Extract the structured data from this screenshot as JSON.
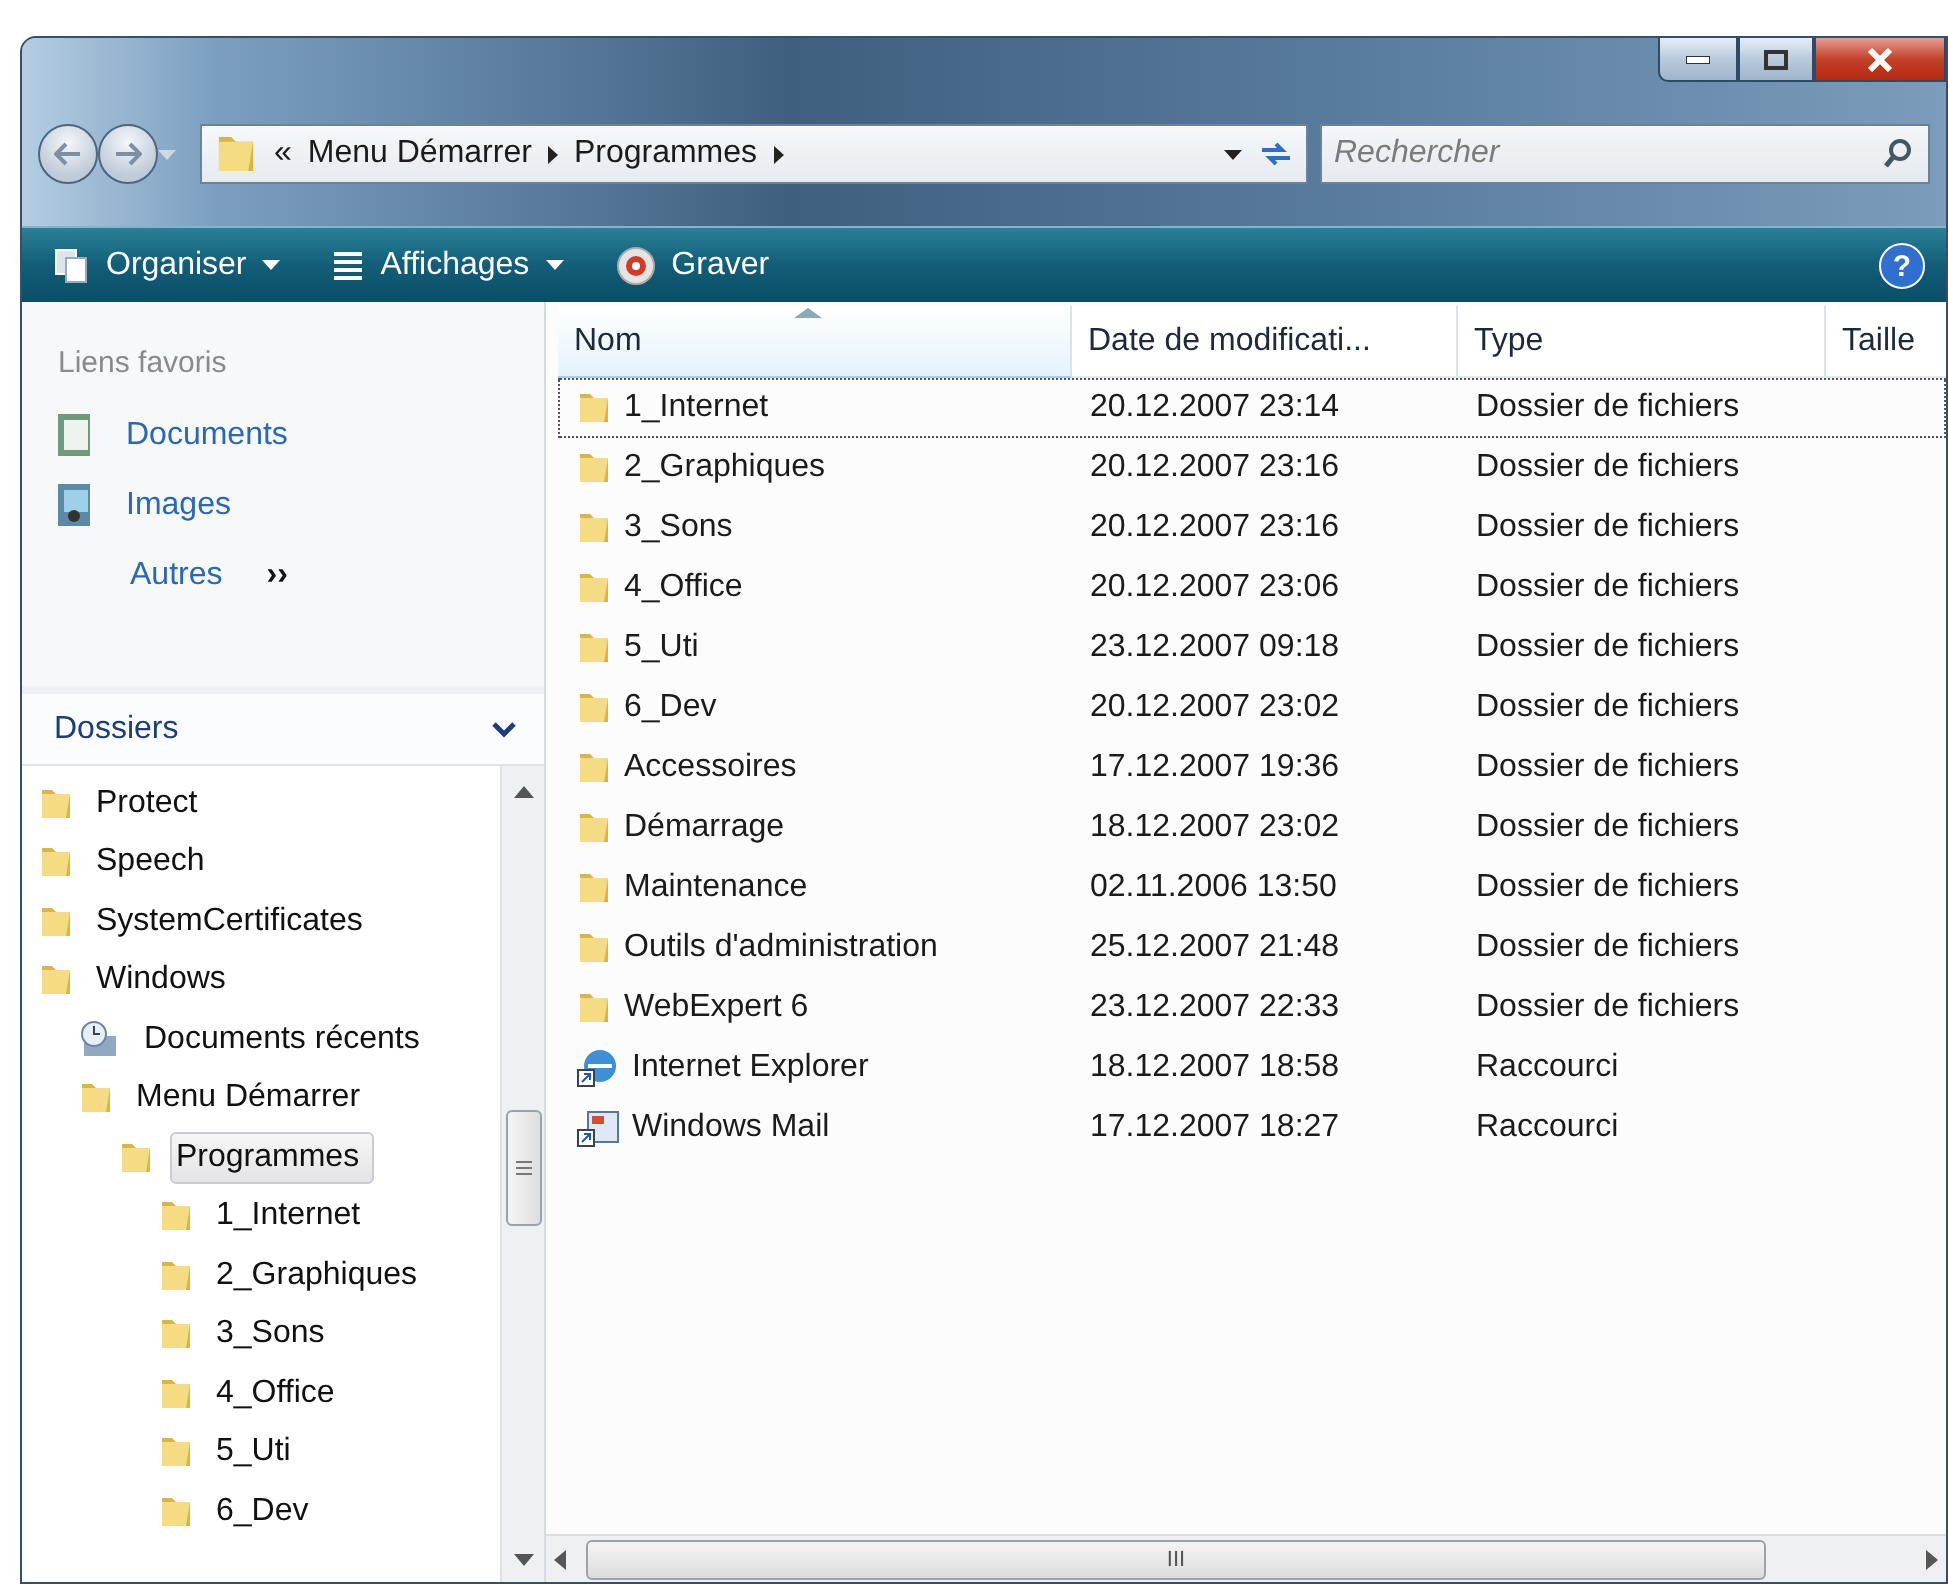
{
  "address_bar": {
    "overflow": "«",
    "crumbs": [
      "Menu Démarrer",
      "Programmes"
    ]
  },
  "search": {
    "placeholder": "Rechercher"
  },
  "toolbar": [
    {
      "label": "Organiser",
      "kind": "organize",
      "dropdown": true
    },
    {
      "label": "Affichages",
      "kind": "views",
      "dropdown": true
    },
    {
      "label": "Graver",
      "kind": "burn",
      "dropdown": false
    }
  ],
  "favorites": {
    "title": "Liens favoris",
    "items": [
      {
        "label": "Documents",
        "kind": "documents"
      },
      {
        "label": "Images",
        "kind": "pictures"
      },
      {
        "label": "Autres",
        "kind": "more"
      }
    ],
    "more_glyph": "››"
  },
  "folders": {
    "title": "Dossiers",
    "expanded": true,
    "tree": [
      {
        "label": "Protect",
        "kind": "folder",
        "selected": false
      },
      {
        "label": "Speech",
        "kind": "folder",
        "selected": false
      },
      {
        "label": "SystemCertificates",
        "kind": "folder",
        "selected": false
      },
      {
        "label": "Windows",
        "kind": "folder",
        "selected": false,
        "children": [
          {
            "label": "Documents récents",
            "kind": "recent",
            "selected": false
          },
          {
            "label": "Menu Démarrer",
            "kind": "folder",
            "selected": false,
            "children": [
              {
                "label": "Programmes",
                "kind": "folder",
                "selected": true,
                "children": [
                  {
                    "label": "1_Internet",
                    "kind": "folder",
                    "selected": false
                  },
                  {
                    "label": "2_Graphiques",
                    "kind": "folder",
                    "selected": false
                  },
                  {
                    "label": "3_Sons",
                    "kind": "folder",
                    "selected": false
                  },
                  {
                    "label": "4_Office",
                    "kind": "folder",
                    "selected": false
                  },
                  {
                    "label": "5_Uti",
                    "kind": "folder",
                    "selected": false
                  },
                  {
                    "label": "6_Dev",
                    "kind": "folder",
                    "selected": false
                  }
                ]
              }
            ]
          }
        ]
      }
    ]
  },
  "table": {
    "columns": [
      {
        "label": "Nom",
        "sorted": true
      },
      {
        "label": "Date de modificati...",
        "sorted": false
      },
      {
        "label": "Type",
        "sorted": false
      },
      {
        "label": "Taille",
        "sorted": false
      }
    ],
    "rows": [
      {
        "kind": "folder",
        "focused": true,
        "cells": [
          "1_Internet",
          "20.12.2007 23:14",
          "Dossier de fichiers"
        ]
      },
      {
        "kind": "folder",
        "focused": false,
        "cells": [
          "2_Graphiques",
          "20.12.2007 23:16",
          "Dossier de fichiers"
        ]
      },
      {
        "kind": "folder",
        "focused": false,
        "cells": [
          "3_Sons",
          "20.12.2007 23:16",
          "Dossier de fichiers"
        ]
      },
      {
        "kind": "folder",
        "focused": false,
        "cells": [
          "4_Office",
          "20.12.2007 23:06",
          "Dossier de fichiers"
        ]
      },
      {
        "kind": "folder",
        "focused": false,
        "cells": [
          "5_Uti",
          "23.12.2007 09:18",
          "Dossier de fichiers"
        ]
      },
      {
        "kind": "folder",
        "focused": false,
        "cells": [
          "6_Dev",
          "20.12.2007 23:02",
          "Dossier de fichiers"
        ]
      },
      {
        "kind": "folder",
        "focused": false,
        "cells": [
          "Accessoires",
          "17.12.2007 19:36",
          "Dossier de fichiers"
        ]
      },
      {
        "kind": "folder",
        "focused": false,
        "cells": [
          "Démarrage",
          "18.12.2007 23:02",
          "Dossier de fichiers"
        ]
      },
      {
        "kind": "folder",
        "focused": false,
        "cells": [
          "Maintenance",
          "02.11.2006 13:50",
          "Dossier de fichiers"
        ]
      },
      {
        "kind": "folder",
        "focused": false,
        "cells": [
          "Outils d'administration",
          "25.12.2007 21:48",
          "Dossier de fichiers"
        ]
      },
      {
        "kind": "folder",
        "focused": false,
        "cells": [
          "WebExpert 6",
          "23.12.2007 22:33",
          "Dossier de fichiers"
        ]
      },
      {
        "kind": "browser",
        "focused": false,
        "cells": [
          "Internet Explorer",
          "18.12.2007 18:58",
          "Raccourci"
        ]
      },
      {
        "kind": "mail",
        "focused": false,
        "cells": [
          "Windows Mail",
          "17.12.2007 18:27",
          "Raccourci"
        ]
      }
    ]
  },
  "scrollbar": {
    "grip": "III"
  },
  "help": {
    "glyph": "?"
  }
}
